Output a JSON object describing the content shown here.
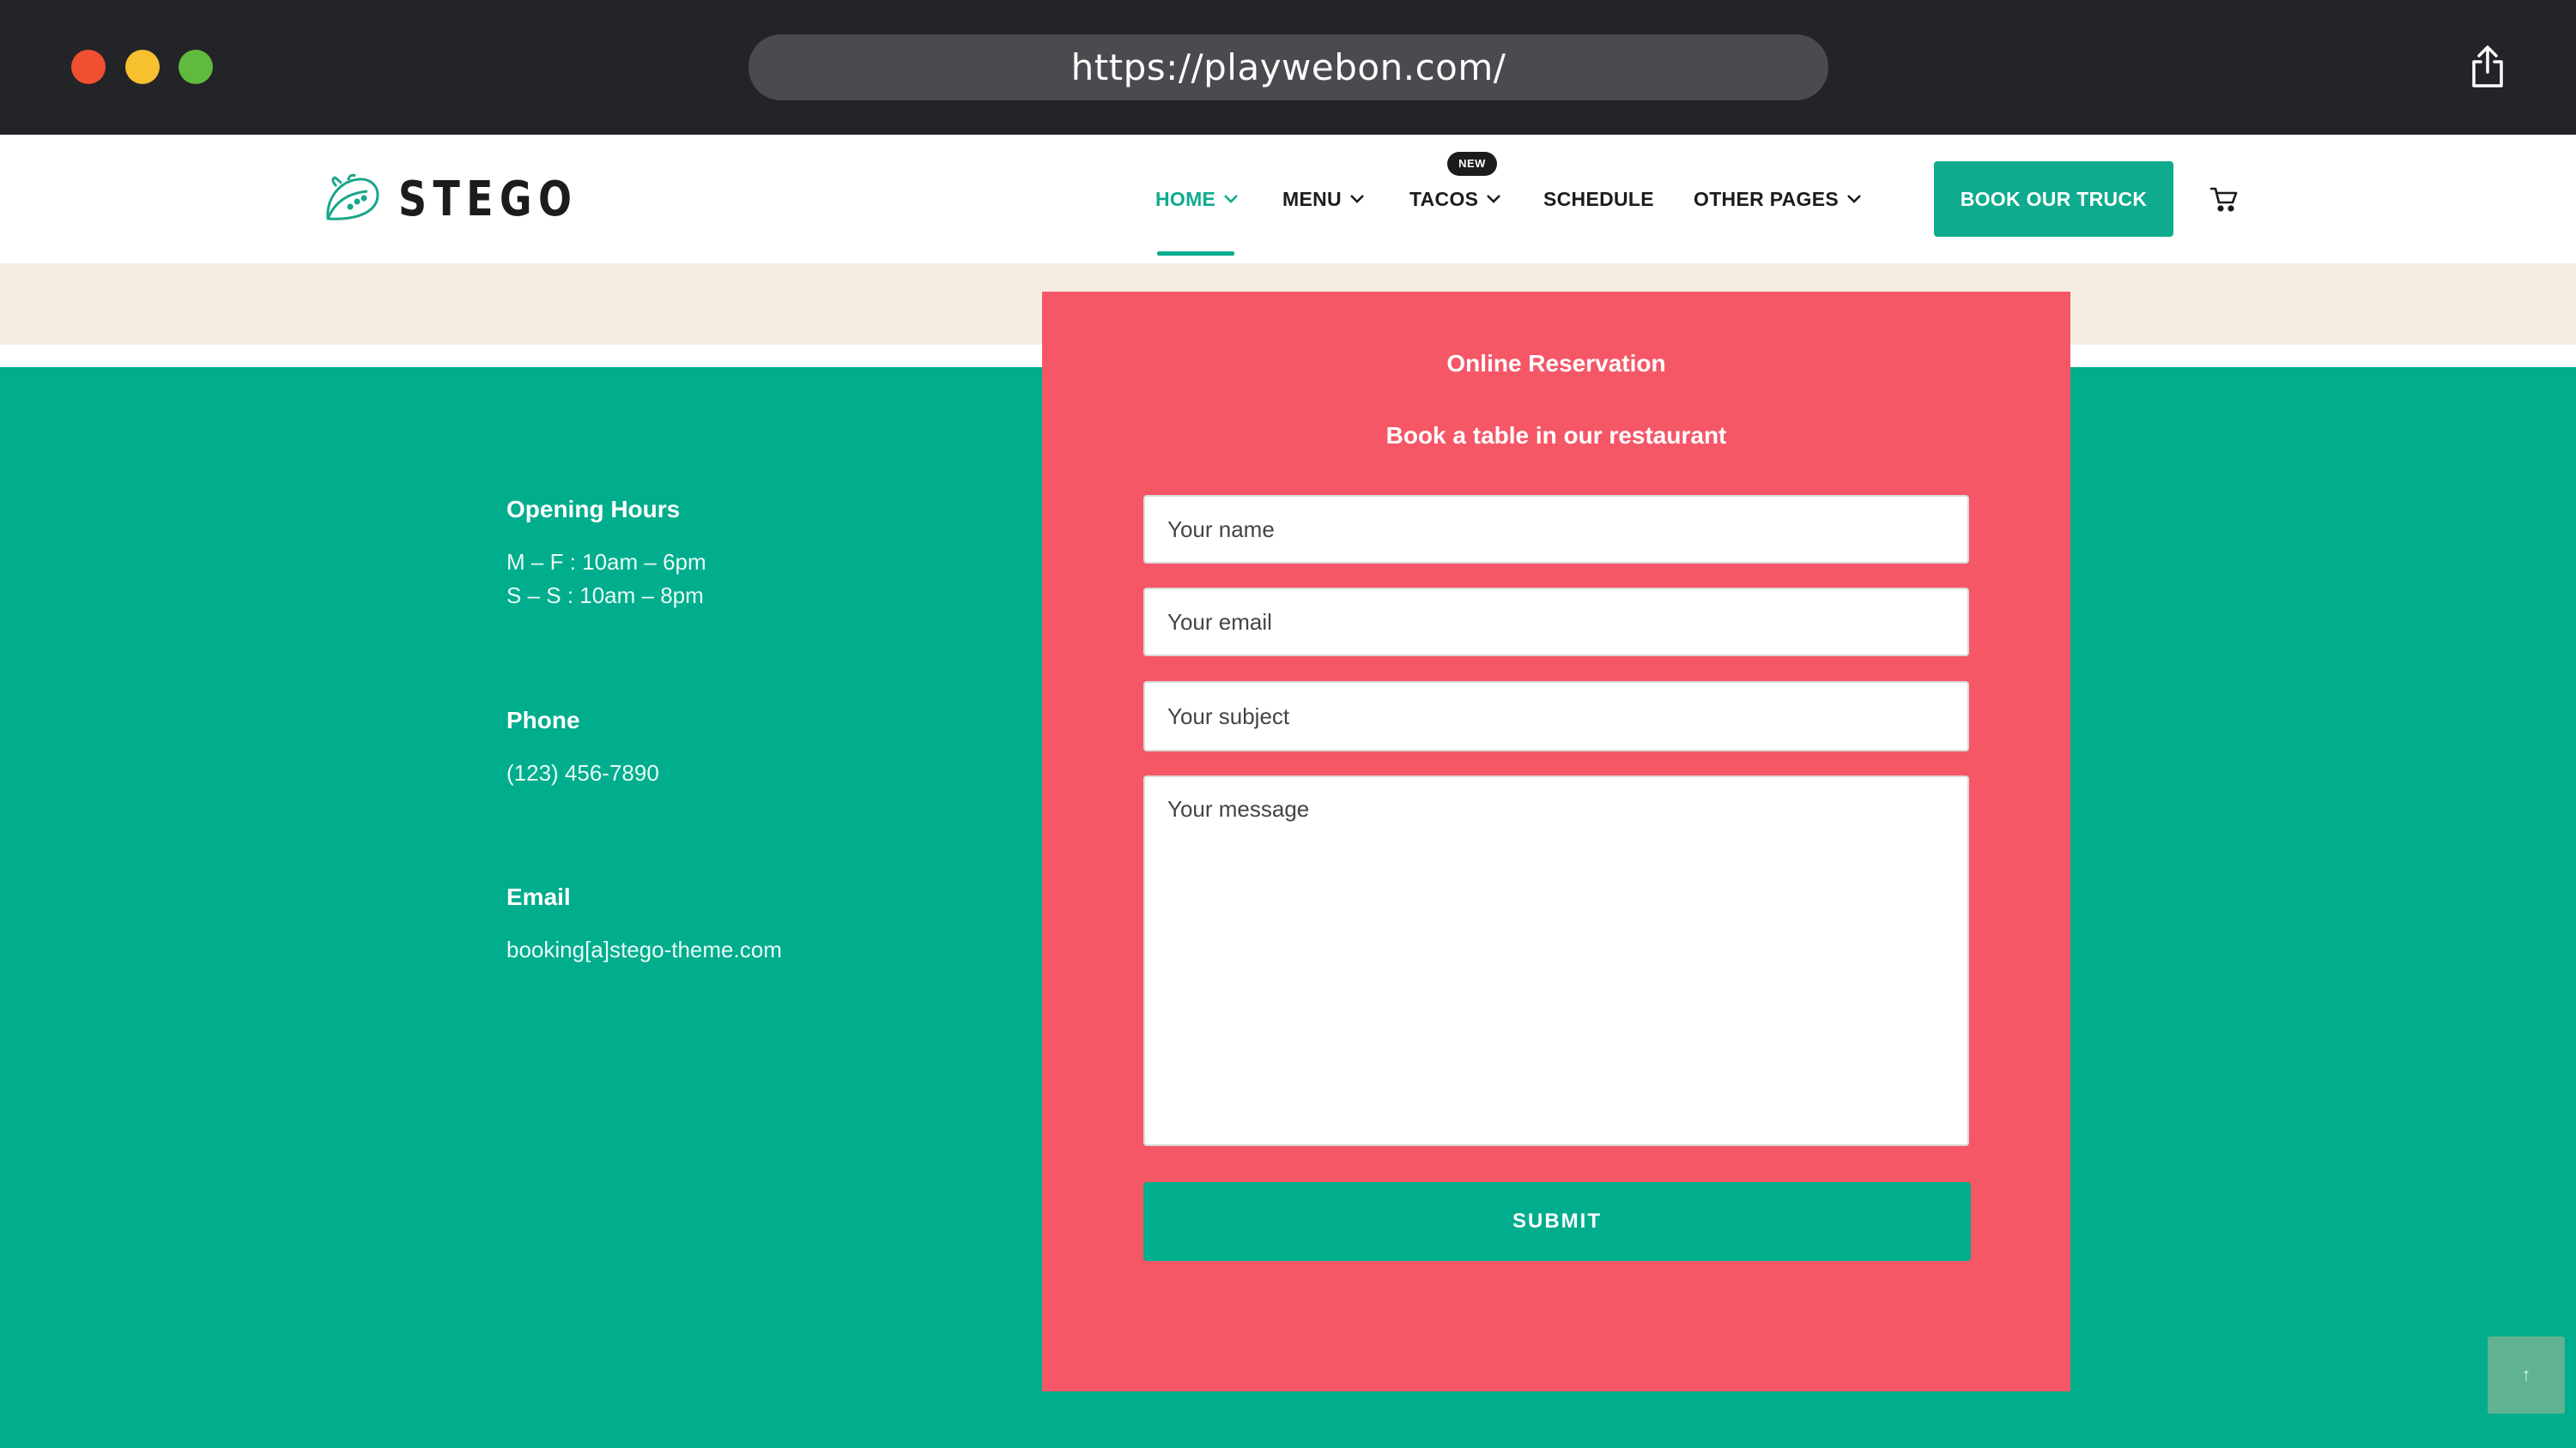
{
  "browser": {
    "url": "https://playwebon.com/",
    "icons": {
      "share": "share-icon"
    },
    "colors": {
      "chrome": "#232428",
      "urlbar": "#4a4b4f",
      "close": "#f04f30",
      "minimize": "#f6c02f",
      "maximize": "#5fba3d"
    }
  },
  "header": {
    "logo_text": "STEGO",
    "nav": [
      {
        "label": "HOME",
        "has_dropdown": true,
        "active": true
      },
      {
        "label": "MENU",
        "has_dropdown": true
      },
      {
        "label": "TACOS",
        "has_dropdown": true,
        "badge": "NEW"
      },
      {
        "label": "SCHEDULE",
        "has_dropdown": false
      },
      {
        "label": "OTHER PAGES",
        "has_dropdown": true
      }
    ],
    "cta_label": "BOOK OUR TRUCK",
    "icons": {
      "logo": "taco-icon",
      "dropdown": "chevron-down-icon",
      "cart": "cart-icon"
    }
  },
  "info": {
    "opening_hours": {
      "heading": "Opening Hours",
      "line1": "M – F : 10am – 6pm",
      "line2": "S – S : 10am – 8pm"
    },
    "phone": {
      "heading": "Phone",
      "value": "(123) 456-7890"
    },
    "email": {
      "heading": "Email",
      "value": "booking[a]stego-theme.com"
    }
  },
  "reservation": {
    "title": "Online Reservation",
    "subtitle": "Book a table in our restaurant",
    "name_placeholder": "Your name",
    "email_placeholder": "Your email",
    "subject_placeholder": "Your subject",
    "message_placeholder": "Your message",
    "submit_label": "SUBMIT"
  },
  "scroll_top": {
    "icon": "arrow-up-icon",
    "glyph": "↑"
  },
  "colors": {
    "accent": "#0eab8e",
    "teal_bg": "#00ad8d",
    "card": "#f55767",
    "beige": "#f6ede2",
    "text_dark": "#1c1c1c"
  }
}
